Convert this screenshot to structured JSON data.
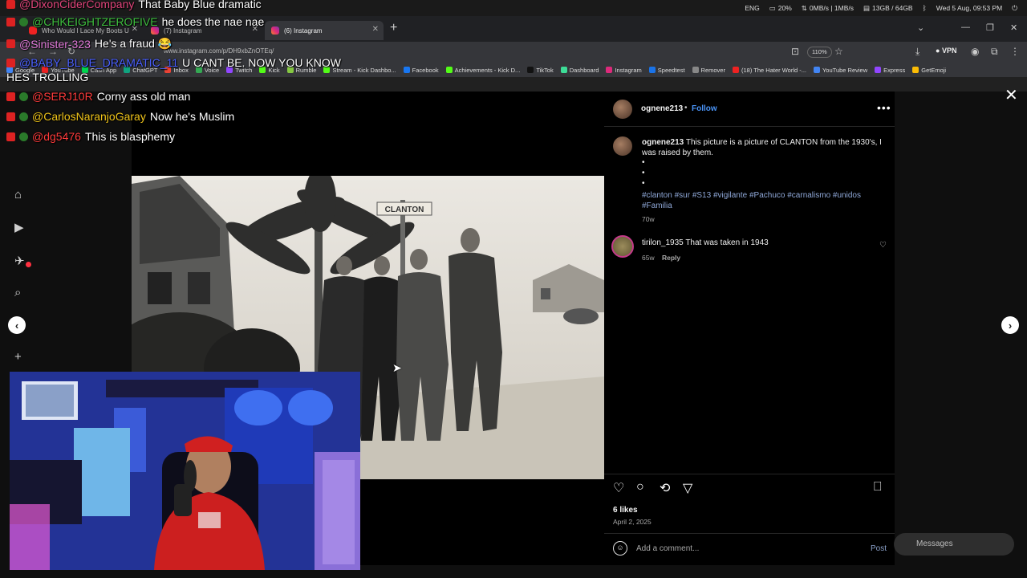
{
  "system_bar": {
    "lang": "ENG",
    "battery": "20%",
    "network": "0MB/s | 1MB/s",
    "memory": "13GB / 64GB",
    "datetime": "Wed 5 Aug, 09:53 PM"
  },
  "browser": {
    "tabs": [
      {
        "label": "Who Would I Lace My Boots U",
        "active": false
      },
      {
        "label": "(7) Instagram",
        "active": false
      },
      {
        "label": "(6) Instagram",
        "active": true
      }
    ],
    "url": "www.instagram.com/p/DH9xbZnOTEq/",
    "zoom": "110%",
    "vpn_label": "VPN",
    "bookmarks": [
      "Google",
      "YouTube",
      "Cash App",
      "ChatGPT",
      "Inbox",
      "Voice",
      "Twitch",
      "Kick",
      "Rumble",
      "Stream - Kick Dashbo...",
      "Facebook",
      "Achievements - Kick D...",
      "TikTok",
      "Dashboard",
      "Instagram",
      "Speedtest",
      "Remover",
      "(18) The Hater World -...",
      "YouTube Review",
      "Express",
      "GetEmoji"
    ]
  },
  "chat": [
    {
      "user": "@DixonCiderCompany",
      "msg": "That Baby Blue dramatic",
      "color": "#e0457b"
    },
    {
      "user": "@CHKEIGHTZEROFIVE",
      "msg": "he does the nae nae",
      "color": "#3fbf3f"
    },
    {
      "user": "@Sinister-323",
      "msg": "He's a fraud 😂",
      "color": "#e07ad8"
    },
    {
      "user": "@BABY_BLUE_DRAMATIC_11",
      "msg": "U CANT BE. NOW YOU KNOW",
      "color": "#4a60ff"
    },
    {
      "user": "",
      "msg": "HES TROLLING",
      "color": "#ffffff"
    },
    {
      "user": "@SERJ10R",
      "msg": "Corny ass old man",
      "color": "#ff3b3b"
    },
    {
      "user": "@CarlosNaranjoGaray",
      "msg": "Now he's Muslim",
      "color": "#f0c419"
    },
    {
      "user": "@dg5476",
      "msg": "This is blasphemy",
      "color": "#ff3b3b"
    }
  ],
  "post": {
    "username": "ognene213",
    "follow_label": "Follow",
    "separator": "•",
    "caption_user": "ognene213",
    "caption": "This picture is a picture of CLANTON from the 1930's, I was raised by them.",
    "bullets": [
      "•",
      "•",
      "•"
    ],
    "hashtags": "#clanton #sur #S13 #vigilante #Pachuco #carnalismo #unidos #Familia",
    "caption_age": "70w",
    "sign_text": "CLANTON",
    "comments": [
      {
        "user": "tirilon_1935",
        "text": "That was taken in 1943",
        "age": "65w",
        "reply_label": "Reply"
      }
    ],
    "likes": "6 likes",
    "date": "April 2, 2025",
    "add_comment_placeholder": "Add a comment...",
    "post_label": "Post"
  },
  "messages_label": "Messages"
}
